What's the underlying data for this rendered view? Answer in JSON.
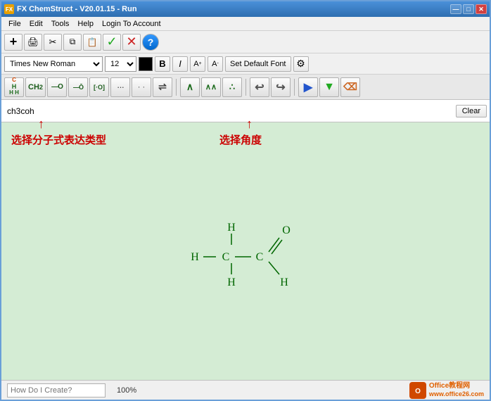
{
  "window": {
    "title": "FX ChemStruct - V20.01.15 - Run",
    "icon_label": "FX"
  },
  "title_buttons": {
    "minimize": "—",
    "maximize": "□",
    "close": "✕"
  },
  "menu": {
    "items": [
      "File",
      "Edit",
      "Tools",
      "Help",
      "Login To Account"
    ]
  },
  "toolbar1": {
    "buttons": [
      {
        "name": "add",
        "icon": "+",
        "label": "Add"
      },
      {
        "name": "print",
        "icon": "🖨",
        "label": "Print"
      },
      {
        "name": "cut",
        "icon": "✂",
        "label": "Cut"
      },
      {
        "name": "copy",
        "icon": "📋",
        "label": "Copy"
      },
      {
        "name": "paste",
        "icon": "📋",
        "label": "Paste"
      },
      {
        "name": "confirm",
        "icon": "✓",
        "label": "Confirm",
        "color": "green"
      },
      {
        "name": "cancel",
        "icon": "✕",
        "label": "Cancel",
        "color": "red"
      },
      {
        "name": "help",
        "icon": "?",
        "label": "Help",
        "color": "blue"
      }
    ]
  },
  "toolbar2": {
    "font_name": "Times New Roman",
    "font_size": "12",
    "bold_label": "B",
    "italic_label": "I",
    "superscript_label": "A⁺",
    "subscript_label": "A₋",
    "set_default_font_label": "Set Default Font",
    "gear_icon": "⚙"
  },
  "toolbar3": {
    "buttons": [
      {
        "name": "ch",
        "display": "CH",
        "sub": "H H"
      },
      {
        "name": "ch2",
        "display": "CH₂"
      },
      {
        "name": "bond-o",
        "display": "—O"
      },
      {
        "name": "bond-o-up",
        "display": "—Ō"
      },
      {
        "name": "bond-o-bracket",
        "display": "[·O]"
      },
      {
        "name": "dots",
        "display": "···"
      },
      {
        "name": "dots2",
        "display": "· ·"
      },
      {
        "name": "double-arrow",
        "display": "⇌"
      },
      {
        "name": "peak1",
        "display": "∧"
      },
      {
        "name": "peak2",
        "display": "∧∧"
      },
      {
        "name": "dots3",
        "display": "∴"
      },
      {
        "name": "undo",
        "display": "↩"
      },
      {
        "name": "redo",
        "display": "↪"
      },
      {
        "name": "arrow-right",
        "display": "▶"
      },
      {
        "name": "arrow-down",
        "display": "▼"
      },
      {
        "name": "eraser",
        "display": "⌫"
      }
    ]
  },
  "input_area": {
    "value": "ch3coh",
    "clear_label": "Clear"
  },
  "annotations": {
    "label1": "选择分子式表达类型",
    "label2": "选择角度"
  },
  "status_bar": {
    "how_create_placeholder": "How Do I Create?",
    "zoom": "100%",
    "office_line1": "Office教程网",
    "office_line2": "www.office26.com"
  },
  "chemical_structure": {
    "formula": "CH3CHO",
    "description": "Acetaldehyde structural formula"
  }
}
